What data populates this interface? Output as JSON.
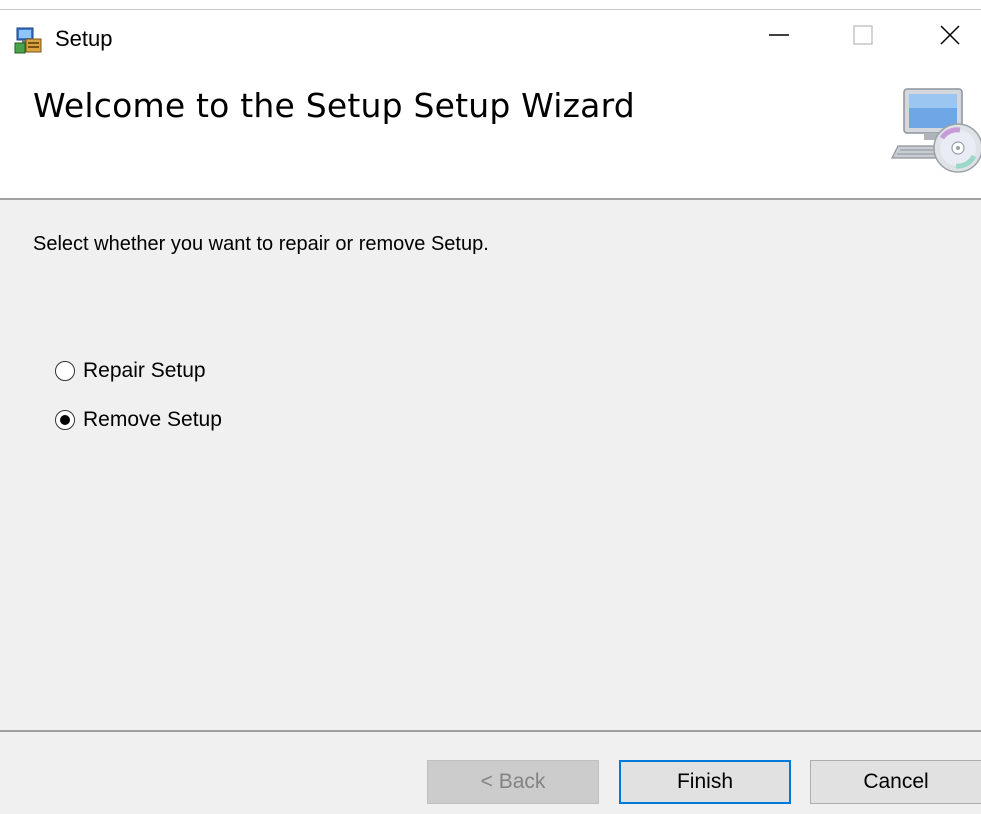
{
  "window": {
    "title": "Setup",
    "app_icon": "setup-installer-icon",
    "controls": {
      "minimize": "minimize-icon",
      "maximize": "maximize-icon",
      "close": "close-icon"
    }
  },
  "banner": {
    "title": "Welcome to the Setup Setup Wizard",
    "icon": "computer-cd-icon"
  },
  "main": {
    "instruction": "Select whether you want to repair or remove Setup.",
    "options": [
      {
        "label": "Repair Setup",
        "selected": false
      },
      {
        "label": "Remove Setup",
        "selected": true
      }
    ]
  },
  "footer": {
    "back_label": "< Back",
    "finish_label": "Finish",
    "cancel_label": "Cancel"
  },
  "colors": {
    "focus_border": "#0078d7",
    "dialog_bg": "#f0f0f0",
    "disabled_text": "#838383"
  }
}
